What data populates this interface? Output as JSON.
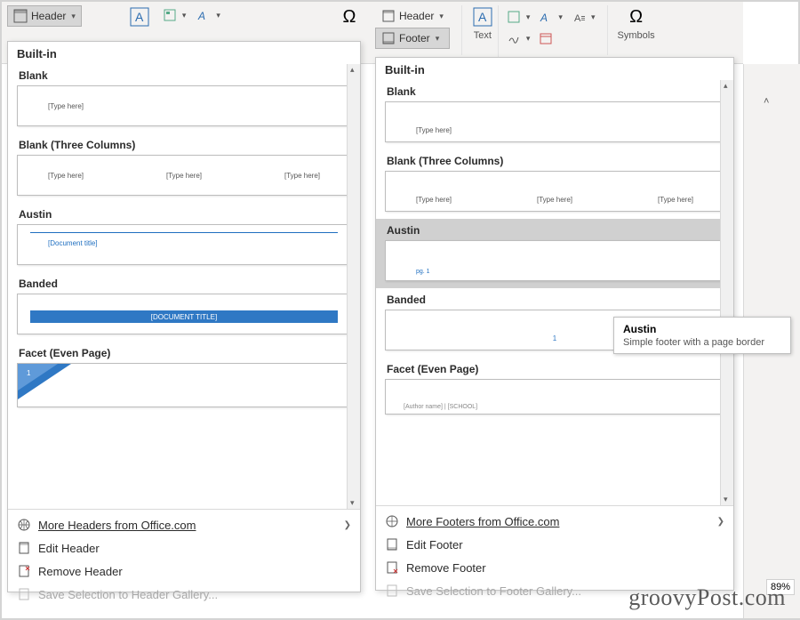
{
  "ribbon": {
    "header_label": "Header",
    "footer_label": "Footer",
    "text_group": "Text",
    "symbols_group": "Symbols",
    "symbol_glyph": "Ω"
  },
  "gallery": {
    "section_builtin": "Built-in",
    "items": {
      "blank": {
        "title": "Blank",
        "placeholder": "[Type here]"
      },
      "blank3": {
        "title": "Blank (Three Columns)",
        "ph1": "[Type here]",
        "ph2": "[Type here]",
        "ph3": "[Type here]"
      },
      "austin_header": {
        "title": "Austin",
        "placeholder": "[Document title]"
      },
      "austin_footer": {
        "title": "Austin",
        "placeholder": "pg. 1"
      },
      "banded_header": {
        "title": "Banded",
        "placeholder": "[DOCUMENT TITLE]"
      },
      "banded_footer": {
        "title": "Banded",
        "placeholder": "1"
      },
      "facet_header": {
        "title": "Facet (Even Page)",
        "num": "1"
      },
      "facet_footer": {
        "title": "Facet (Even Page)",
        "placeholder": "[Author name] | [SCHOOL]"
      }
    }
  },
  "menu_header": {
    "more": "More Headers from Office.com",
    "edit": "Edit Header",
    "remove": "Remove Header",
    "save": "Save Selection to Header Gallery..."
  },
  "menu_footer": {
    "more": "More Footers from Office.com",
    "edit": "Edit Footer",
    "remove": "Remove Footer",
    "save": "Save Selection to Footer Gallery..."
  },
  "tooltip": {
    "title": "Austin",
    "desc": "Simple footer with a page border"
  },
  "status": {
    "zoom": "89%"
  },
  "watermark": "groovyPost.com"
}
